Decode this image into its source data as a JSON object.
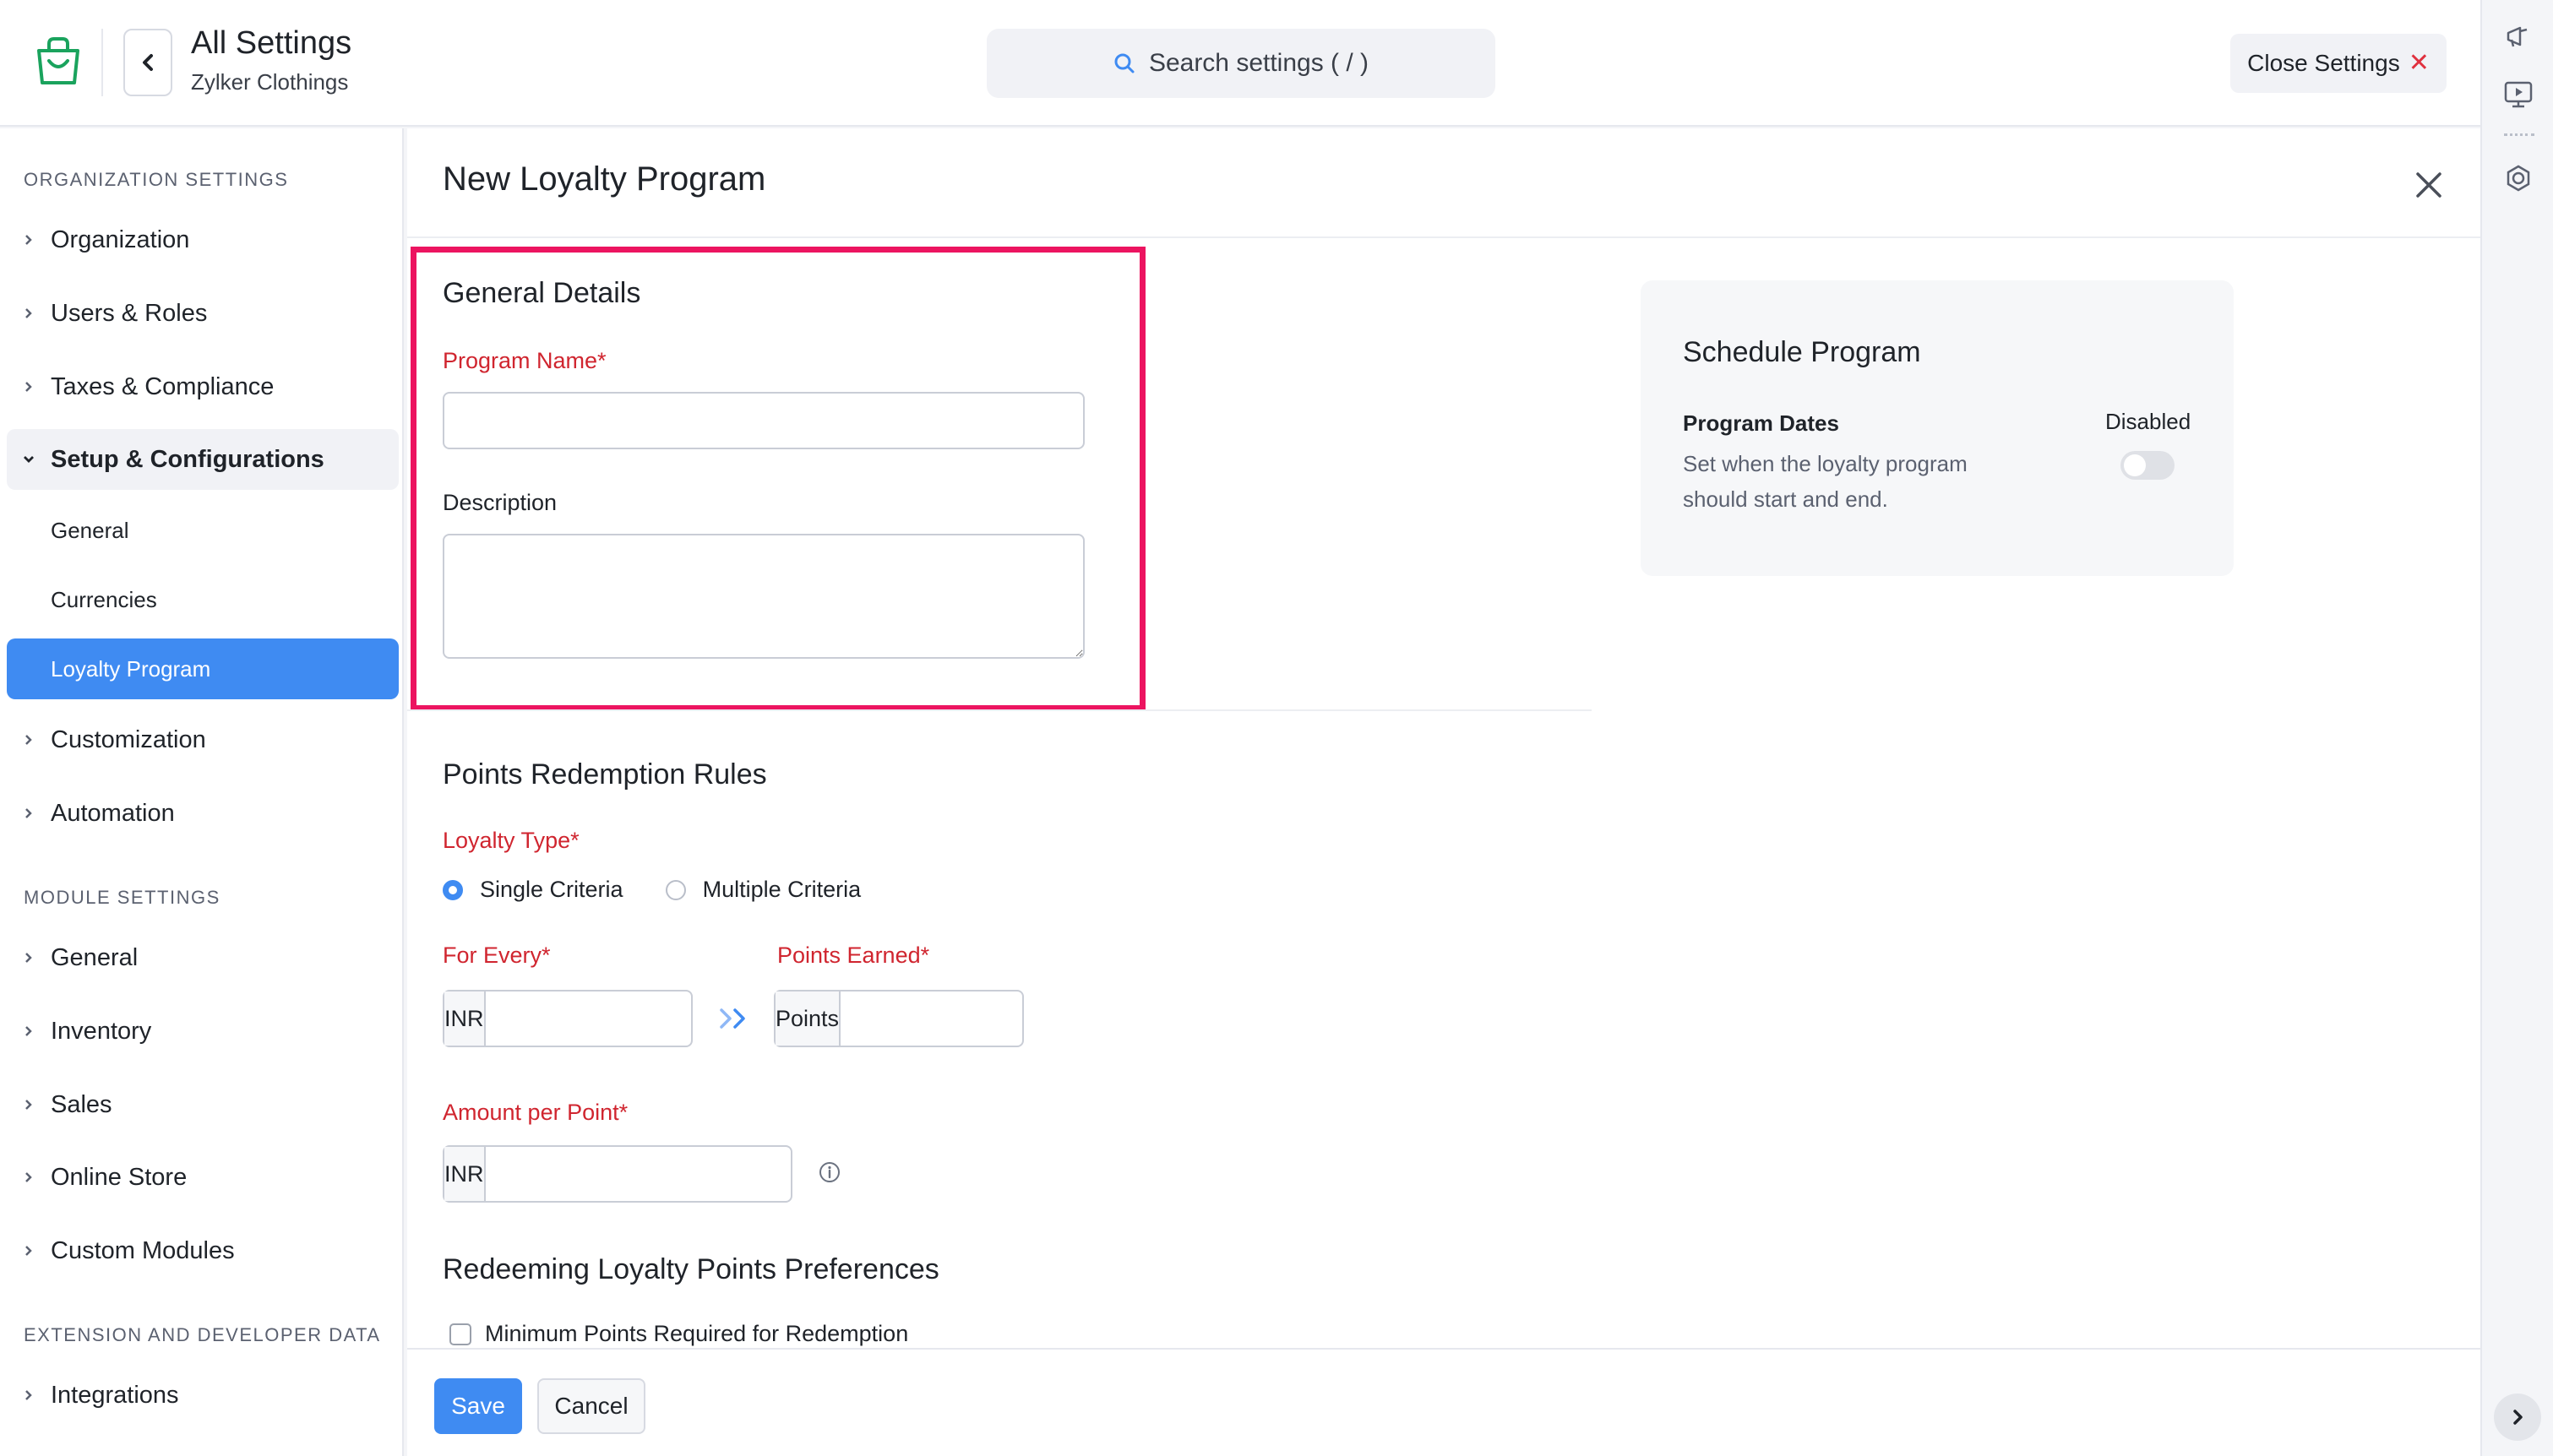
{
  "header": {
    "title": "All Settings",
    "subtitle": "Zylker Clothings",
    "search_placeholder": "Search settings ( / )",
    "close_label": "Close Settings",
    "close_icon": "close-icon"
  },
  "sidebar": {
    "org_heading": "ORGANIZATION SETTINGS",
    "module_heading": "MODULE SETTINGS",
    "ext_heading": "EXTENSION AND DEVELOPER DATA",
    "items": [
      {
        "label": "Organization"
      },
      {
        "label": "Users & Roles"
      },
      {
        "label": "Taxes & Compliance"
      },
      {
        "label": "Setup & Configurations"
      },
      {
        "label": "General"
      },
      {
        "label": "Currencies"
      },
      {
        "label": "Loyalty Program"
      },
      {
        "label": "Customization"
      },
      {
        "label": "Automation"
      }
    ],
    "module_items": [
      {
        "label": "General"
      },
      {
        "label": "Inventory"
      },
      {
        "label": "Sales"
      },
      {
        "label": "Online Store"
      },
      {
        "label": "Custom Modules"
      }
    ],
    "ext_items": [
      {
        "label": "Integrations"
      }
    ]
  },
  "panel": {
    "title": "New Loyalty Program",
    "general": {
      "title": "General Details",
      "program_name_label": "Program Name*",
      "program_name_value": "",
      "description_label": "Description",
      "description_value": ""
    },
    "redemption": {
      "title": "Points Redemption Rules",
      "loyalty_type_label": "Loyalty Type*",
      "option_single": "Single Criteria",
      "option_multiple": "Multiple Criteria",
      "selected_option": "Single Criteria",
      "for_every_label": "For Every*",
      "for_every_currency": "INR",
      "for_every_value": "",
      "points_earned_label": "Points Earned*",
      "points_addon": "Points",
      "points_value": "",
      "amount_per_point_label": "Amount per Point*",
      "amount_currency": "INR",
      "amount_value": ""
    },
    "preferences": {
      "title": "Redeeming Loyalty Points Preferences",
      "min_points_label": "Minimum Points Required for Redemption",
      "min_points_checked": false
    },
    "schedule": {
      "title": "Schedule Program",
      "dates_label": "Program Dates",
      "dates_desc": "Set when the loyalty program should start and end.",
      "status": "Disabled",
      "enabled": false
    }
  },
  "footer": {
    "save_label": "Save",
    "cancel_label": "Cancel"
  },
  "colors": {
    "accent": "#3f8bf2",
    "required": "#d0252f",
    "highlight": "#ec1460"
  }
}
